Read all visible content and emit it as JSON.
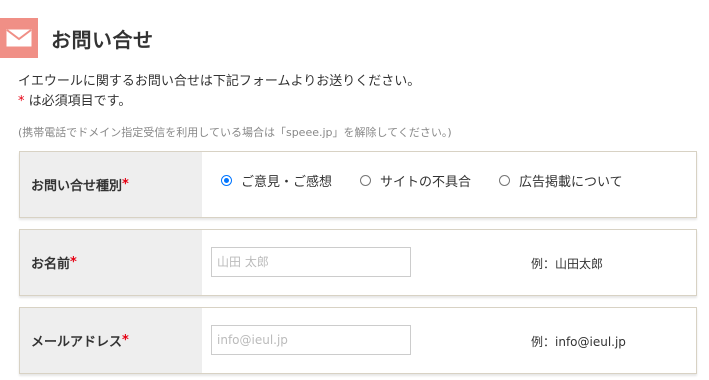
{
  "header": {
    "icon": "mail-icon",
    "accent_color": "#f08f86",
    "title": "お問い合せ"
  },
  "intro": {
    "line1": "イエウールに関するお問い合せは下記フォームよりお送りください。",
    "required_mark": "*",
    "required_text": " は必須項目です。"
  },
  "note": "(携帯電話でドメイン指定受信を利用している場合は「speee.jp」を解除してください。)",
  "form": {
    "inquiry_type": {
      "label": "お問い合せ種別",
      "required_mark": "*",
      "options": [
        {
          "label": "ご意見・ご感想",
          "checked": true
        },
        {
          "label": "サイトの不具合",
          "checked": false
        },
        {
          "label": "広告掲載について",
          "checked": false
        }
      ]
    },
    "name": {
      "label": "お名前",
      "required_mark": "*",
      "placeholder": "山田 太郎",
      "value": "",
      "example": "例：山田太郎"
    },
    "email": {
      "label": "メールアドレス",
      "required_mark": "*",
      "placeholder": "info@ieul.jp",
      "value": "",
      "example": "例：info@ieul.jp"
    }
  },
  "colors": {
    "required": "#e60012",
    "radio_selected": "#0075ff",
    "label_bg": "#eeeeee"
  }
}
